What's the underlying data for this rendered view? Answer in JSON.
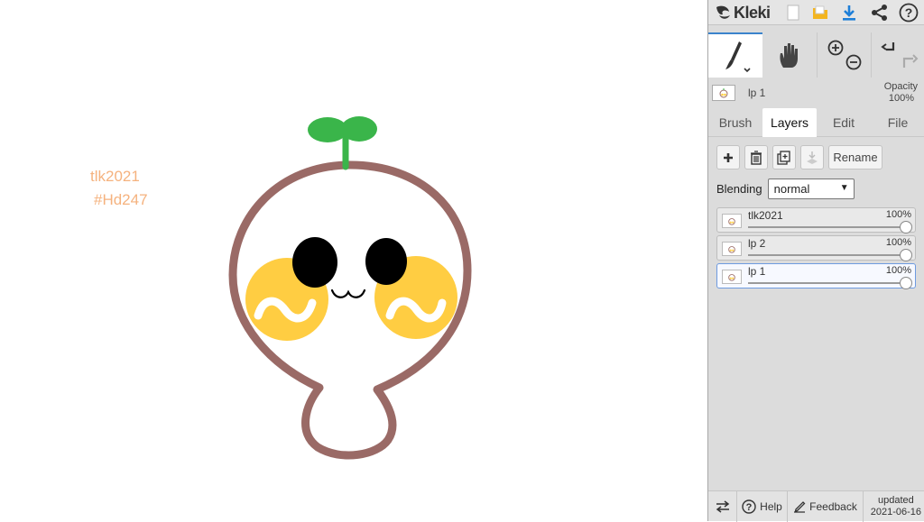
{
  "canvas": {
    "text_line1": "tlk2021",
    "text_line2": "#Hd247",
    "text_color": "#f5b27e",
    "colors": {
      "outline": "#9a6a66",
      "cheek": "#ffcd42",
      "sprout": "#3ab54a",
      "eye": "#000000"
    }
  },
  "app": {
    "name": "Kleki"
  },
  "toolbar": {
    "icons": [
      "kleki-logo-icon",
      "new-image-icon",
      "open-folder-icon",
      "download-icon",
      "share-icon",
      "help-icon"
    ]
  },
  "tools": {
    "brush_icon": "brush-icon",
    "hand_icon": "hand-icon",
    "zoom_in_icon": "zoom-in-icon",
    "zoom_out_icon": "zoom-out-icon",
    "undo_icon": "undo-icon",
    "redo_icon": "redo-icon"
  },
  "current_layer": {
    "name": "lp 1",
    "opacity_label": "Opacity",
    "opacity_value": "100%"
  },
  "tabs": {
    "brush": "Brush",
    "layers": "Layers",
    "edit": "Edit",
    "file": "File",
    "active": "Layers"
  },
  "layer_actions": {
    "rename": "Rename"
  },
  "blending": {
    "label": "Blending",
    "value": "normal"
  },
  "layers": [
    {
      "name": "tlk2021",
      "opacity": "100%",
      "level": 1.0,
      "selected": false
    },
    {
      "name": "lp 2",
      "opacity": "100%",
      "level": 1.0,
      "selected": false
    },
    {
      "name": "lp 1",
      "opacity": "100%",
      "level": 1.0,
      "selected": true
    }
  ],
  "bottom": {
    "help": "Help",
    "feedback": "Feedback",
    "updated_label": "updated",
    "updated_date": "2021-06-16"
  },
  "colors": {
    "accent": "#3b83cc",
    "panel_bg": "#dcdcdc"
  }
}
